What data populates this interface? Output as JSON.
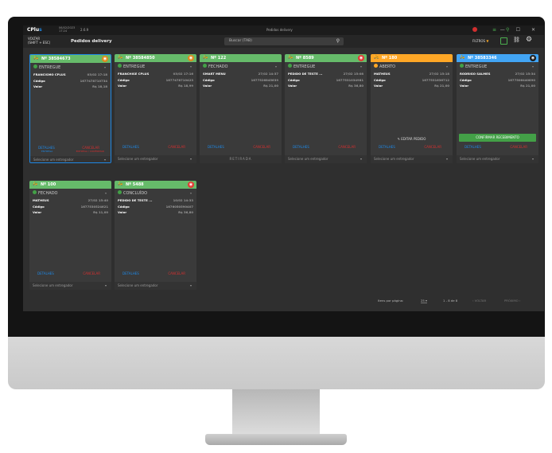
{
  "titlebar": {
    "logo_prefix": "CPlu",
    "logo_suffix": "s",
    "date": "06/02/2023",
    "time": "17:24",
    "version": "2.6.9",
    "window_title": "Pedidos delivery",
    "controls": "— ☐ ✕"
  },
  "toolbar": {
    "back_label": "VOLTAR",
    "back_shortcut": "(SHIFT + ESC)",
    "title": "Pedidos delivery",
    "search_placeholder": "Buscar (TAB)",
    "filters_label": "FILTROS"
  },
  "cards": [
    {
      "number": "Nº 38584673",
      "head_color": "#66bb6a",
      "badge_color": "#e08a1e",
      "badge": "◉",
      "status": "ENTREGUE",
      "status_color": "#43a047",
      "name": "FRANCISMO CPLUS",
      "time": "03/02 17:18",
      "cod_label": "Código",
      "cod_value": "1677478710734",
      "val_label": "Valor",
      "val_value": "R$ 18,18",
      "details": "DETALHES",
      "details_sub": "ENTREGA",
      "cancel": "CANCELAR",
      "cancel_sub": "ENTREGA / CONFIRMAR",
      "deliverer": "Selecione um entregador",
      "selected": true
    },
    {
      "number": "Nº 38584850",
      "head_color": "#66bb6a",
      "badge_color": "#e08a1e",
      "badge": "◉",
      "status": "ENTREGUE",
      "status_color": "#43a047",
      "name": "FRANCHISE CPLUS",
      "time": "03/02 17:16",
      "cod_label": "Código",
      "cod_value": "1677478710423",
      "val_label": "Valor",
      "val_value": "R$ 18,99",
      "details": "DETALHES",
      "cancel": "CANCELAR",
      "deliverer": "Selecione um entregador"
    },
    {
      "number": "Nº 122",
      "head_color": "#66bb6a",
      "badge_color": "",
      "badge": "",
      "status": "FECHADO",
      "status_color": "#43a047",
      "name": "SMART MENU",
      "time": "27/02 14:37",
      "cod_label": "Código",
      "cod_value": "1677526845639",
      "val_label": "Valor",
      "val_value": "R$ 21,00",
      "details": "DETALHES",
      "cancel": "CANCELAR",
      "deliverer": "RETIRADA",
      "deliverer_center": true
    },
    {
      "number": "Nº 8589",
      "head_color": "#66bb6a",
      "badge_color": "#e53935",
      "badge": "◉",
      "status": "ENTREGUE",
      "status_color": "#43a047",
      "name": "PEDIDO DE TESTE ...",
      "time": "27/02 15:08",
      "cod_label": "Código",
      "cod_value": "1677531034981",
      "val_label": "Valor",
      "val_value": "R$ 36,80",
      "details": "DETALHES",
      "cancel": "CANCELAR",
      "deliverer": "Selecione um entregador"
    },
    {
      "number": "Nº 180",
      "head_color": "#ffa726",
      "badge_color": "",
      "badge": "",
      "status": "ABERTO",
      "status_color": "#ffa726",
      "name": "MATHEUS",
      "time": "27/02 15:18",
      "cod_label": "Código",
      "cod_value": "1677531636712",
      "val_label": "Valor",
      "val_value": "R$ 21,00",
      "edit": "✎ EDITAR PEDIDO",
      "details": "DETALHES",
      "cancel": "CANCELAR",
      "deliverer": "Selecione um entregador"
    },
    {
      "number": "Nº 38583346",
      "head_color": "#42a5f5",
      "badge_color": "",
      "badge": "◉",
      "status": "ENTREGUE",
      "status_color": "#43a047",
      "name": "RODRIGO SALMES",
      "time": "27/02 15:34",
      "cod_label": "Código",
      "cod_value": "1677506440890",
      "val_label": "Valor",
      "val_value": "R$ 21,00",
      "confirm": "CONFIRMAR RECEBIMENTO",
      "details": "DETALHES",
      "cancel": "CANCELAR",
      "deliverer": "Selecione um entregador"
    },
    {
      "number": "Nº 100",
      "head_color": "#66bb6a",
      "badge_color": "",
      "badge": "",
      "status": "FECHADO",
      "status_color": "#43a047",
      "name": "MATHEUS",
      "time": "27/02 15:40",
      "cod_label": "Código",
      "cod_value": "1677530524621",
      "val_label": "Valor",
      "val_value": "R$ 11,00",
      "details": "DETALHES",
      "cancel": "CANCELAR",
      "deliverer": "Selecione um entregador"
    },
    {
      "number": "Nº 5488",
      "head_color": "#66bb6a",
      "badge_color": "#e53935",
      "badge": "◉",
      "status": "CONCLUÍDO",
      "status_color": "#43a047",
      "name": "PEDIDO DE TESTE ...",
      "time": "10/02 14:33",
      "cod_label": "Código",
      "cod_value": "1676050590407",
      "val_label": "Valor",
      "val_value": "R$ 36,80",
      "details": "DETALHES",
      "cancel": "CANCELAR",
      "deliverer": "Selecione um entregador"
    }
  ],
  "pagination": {
    "per_page_label": "Itens por página:",
    "per_page": "25",
    "range": "1 - 8 de 8",
    "prev": "‹ VOLTAR",
    "next": "PRÓXIMO ›"
  }
}
